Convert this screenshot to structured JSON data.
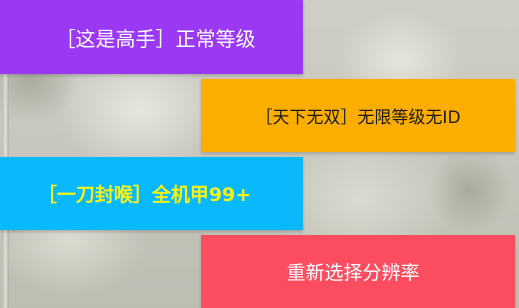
{
  "menu": {
    "pro_mode": {
      "label": "［这是高手］正常等级",
      "bg_color": "#9b38f3",
      "text_color": "#ffffff"
    },
    "unrivaled_mode": {
      "label": "［天下无双］无限等级无ID",
      "bg_color": "#fbad00",
      "text_color": "#1a1a1a"
    },
    "one_hit_mode": {
      "label": "［一刀封喉］全机甲99+",
      "bg_color": "#0ab9fb",
      "text_color": "#f4f21a"
    },
    "reselect_resolution": {
      "label": "重新选择分辨率",
      "bg_color": "#fb4c60",
      "text_color": "#ffffff"
    }
  }
}
